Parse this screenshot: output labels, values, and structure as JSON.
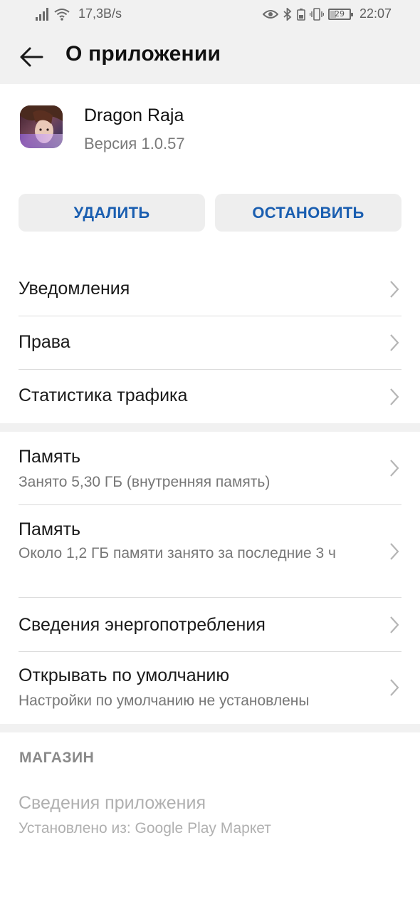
{
  "status_bar": {
    "net_speed": "17,3B/s",
    "battery": "29",
    "battery_level": 0.29,
    "time": "22:07"
  },
  "app_bar": {
    "title": "О приложении"
  },
  "app": {
    "name": "Dragon Raja",
    "version": "Версия 1.0.57"
  },
  "buttons": {
    "uninstall": "УДАЛИТЬ",
    "stop": "ОСТАНОВИТЬ"
  },
  "group1": [
    {
      "title": "Уведомления"
    },
    {
      "title": "Права"
    },
    {
      "title": "Статистика трафика"
    }
  ],
  "group2": [
    {
      "title": "Память",
      "sub": "Занято 5,30 ГБ (внутренняя память)"
    },
    {
      "title": "Память",
      "sub": "Около 1,2 ГБ памяти занято за последние 3 ч"
    },
    {
      "title": "Сведения энергопотребления"
    },
    {
      "title": "Открывать по умолчанию",
      "sub": "Настройки по умолчанию не установлены"
    }
  ],
  "store": {
    "header": "МАГАЗИН",
    "title": "Сведения приложения",
    "sub": "Установлено из: Google Play Маркет"
  },
  "colors": {
    "accent": "#1a5eb0",
    "background_gray": "#f1f1f1"
  }
}
